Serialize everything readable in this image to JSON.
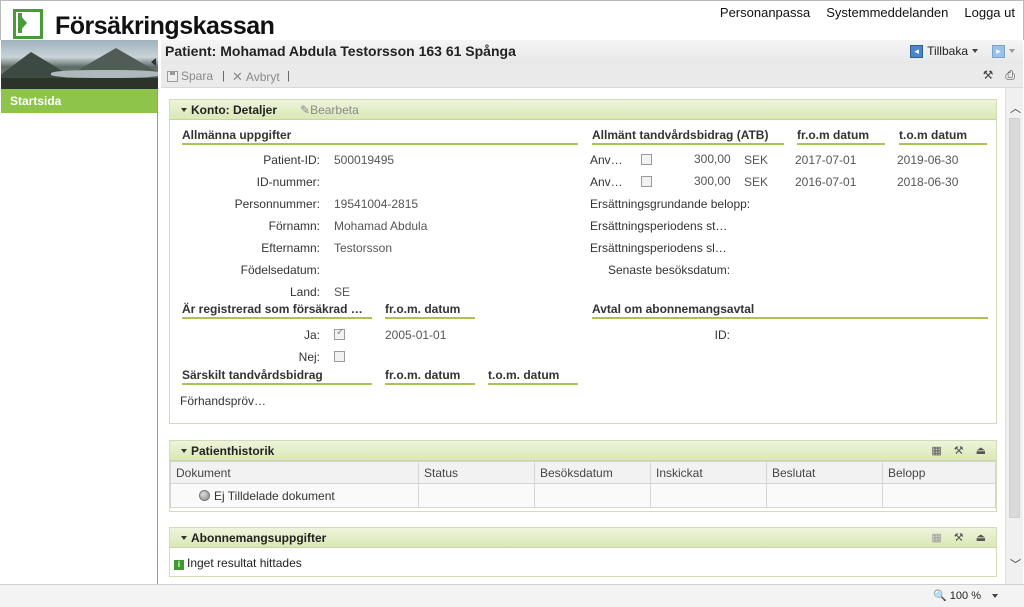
{
  "brand": "Försäkringskassan",
  "top_links": {
    "personalize": "Personanpassa",
    "system_messages": "Systemmeddelanden",
    "logout": "Logga ut"
  },
  "page_title": "Patient: Mohamad Abdula Testorsson 163 61 Spånga",
  "back_label": "Tillbaka",
  "toolbar": {
    "save": "Spara",
    "cancel": "Avbryt"
  },
  "nav": {
    "startsida": "Startsida"
  },
  "konto": {
    "title": "Konto: Detaljer",
    "edit": "Bearbeta",
    "general": {
      "heading": "Allmänna uppgifter",
      "patient_id_label": "Patient-ID:",
      "patient_id": "500019495",
      "id_nummer_label": "ID-nummer:",
      "personnummer_label": "Personnummer:",
      "personnummer": "19541004-2815",
      "fornamn_label": "Förnamn:",
      "fornamn": "Mohamad Abdula",
      "efternamn_label": "Efternamn:",
      "efternamn": "Testorsson",
      "fodelsedatum_label": "Födelsedatum:",
      "land_label": "Land:",
      "land": "SE"
    },
    "atb": {
      "heading": "Allmänt tandvårdsbidrag (ATB)",
      "from_heading": "fr.o.m datum",
      "to_heading": "t.o.m datum",
      "rows": [
        {
          "label": "Anv…",
          "amount": "300,00",
          "currency": "SEK",
          "from": "2017-07-01",
          "to": "2019-06-30"
        },
        {
          "label": "Anv…",
          "amount": "300,00",
          "currency": "SEK",
          "from": "2016-07-01",
          "to": "2018-06-30"
        }
      ],
      "ersattningsgrundande": "Ersättningsgrundande belopp:",
      "period_start": "Ersättningsperiodens st…",
      "period_end": "Ersättningsperiodens sl…",
      "senaste_besok": "Senaste besöksdatum:"
    },
    "insured": {
      "heading": "Är registrerad som försäkrad …",
      "from_heading": "fr.o.m. datum",
      "ja_label": "Ja:",
      "ja_checked": true,
      "ja_date": "2005-01-01",
      "nej_label": "Nej:",
      "nej_checked": false
    },
    "subscription": {
      "heading": "Avtal om abonnemangsavtal",
      "id_label": "ID:"
    },
    "special": {
      "heading": "Särskilt tandvårdsbidrag",
      "from_heading": "fr.o.m. datum",
      "to_heading": "t.o.m. datum",
      "forhandsprov": "Förhandspröv…"
    }
  },
  "history": {
    "title": "Patienthistorik",
    "columns": [
      "Dokument",
      "Status",
      "Besöksdatum",
      "Inskickat",
      "Beslutat",
      "Belopp"
    ],
    "row_label": "Ej Tilldelade dokument"
  },
  "abonnemang": {
    "title": "Abonnemangsuppgifter",
    "no_result": "Inget resultat hittades"
  },
  "zoom": "100 %",
  "colors": {
    "accent_green": "#8ec44a",
    "panel_header": "#dbe8b5",
    "section_underline": "#a8c456"
  }
}
